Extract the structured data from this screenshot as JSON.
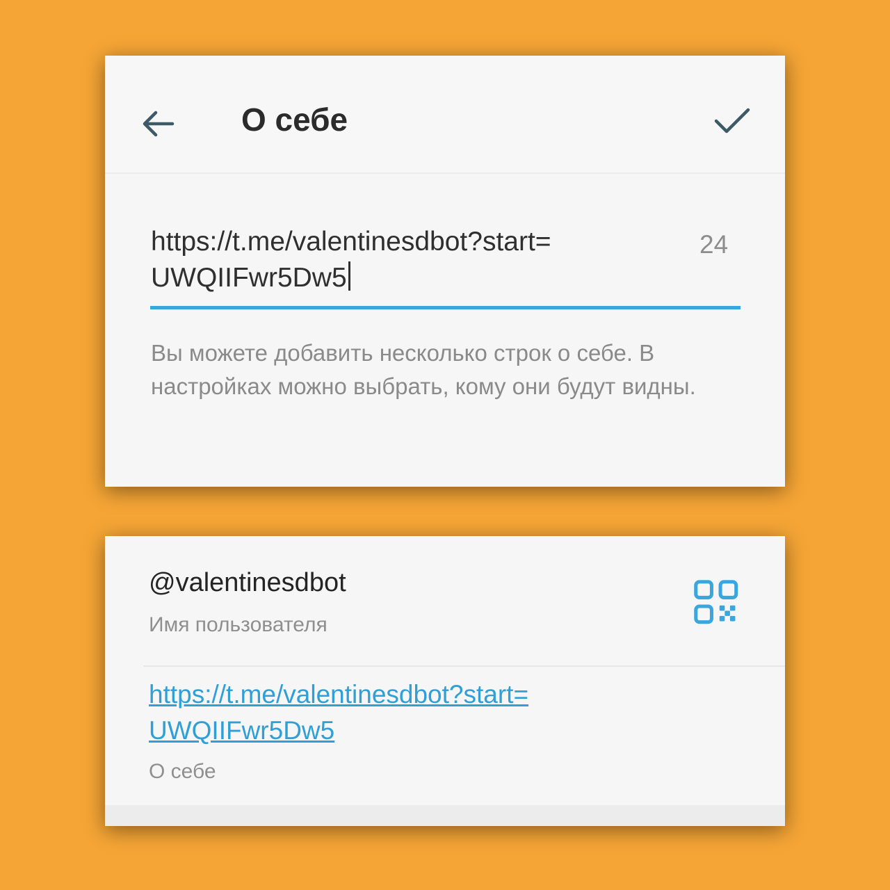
{
  "colors": {
    "background": "#f5a535",
    "accent": "#3aa6dd",
    "link": "#2f9fd6"
  },
  "edit_screen": {
    "title": "О себе",
    "back_icon": "arrow-left-icon",
    "confirm_icon": "checkmark-icon",
    "bio": {
      "line1": "https://t.me/valentinesdbot?start=",
      "line2": "UWQIIFwr5Dw5",
      "remaining_chars": "24"
    },
    "hint": "Вы можете добавить несколько строк о себе. В настройках можно выбрать, кому они будут видны."
  },
  "profile_screen": {
    "username": "@valentinesdbot",
    "username_label": "Имя пользователя",
    "qr_icon": "qr-code-icon",
    "bio_link": {
      "line1": "https://t.me/valentinesdbot?start=",
      "line2": "UWQIIFwr5Dw5"
    },
    "bio_label": "О себе"
  }
}
